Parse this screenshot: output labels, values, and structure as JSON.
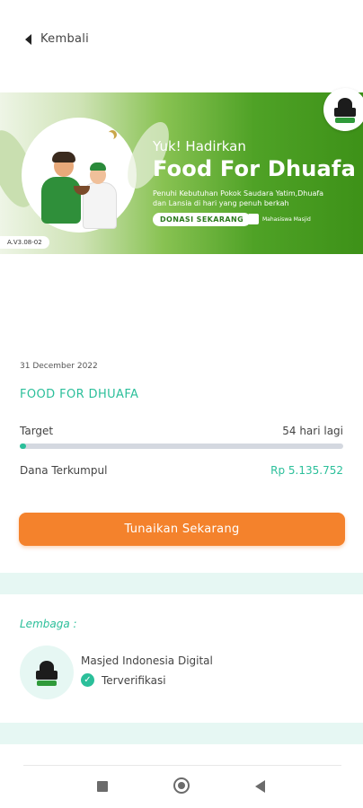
{
  "header": {
    "back_label": "Kembali"
  },
  "banner": {
    "line1": "Yuk! Hadirkan",
    "title": "Food For Dhuafa",
    "description": "Penuhi Kebutuhan Pokok Saudara Yatim,Dhuafa dan Lansia di hari yang penuh berkah",
    "cta": "DONASI SEKARANG",
    "partner": "Mahasiswa Masjid",
    "version": "A.V3.08-02"
  },
  "campaign": {
    "date": "31 December 2022",
    "title": "FOOD FOR DHUAFA",
    "target_label": "Target",
    "target_value": "54 hari lagi",
    "progress_fraction": 0.02,
    "collected_label": "Dana Terkumpul",
    "collected_value": "Rp 5.135.752",
    "button_label": "Tunaikan Sekarang"
  },
  "organization": {
    "section_label": "Lembaga :",
    "name": "Masjed Indonesia Digital",
    "status": "Terverifikasi"
  },
  "colors": {
    "accent_teal": "#2bbf9a",
    "button_orange": "#f4822c",
    "banner_green": "#4fa226"
  },
  "icons": {
    "back": "back-arrow-icon",
    "verified": "check-circle-icon",
    "logo": "mosque-logo-icon",
    "nav": [
      "square-icon",
      "circle-icon",
      "triangle-back-icon"
    ]
  }
}
